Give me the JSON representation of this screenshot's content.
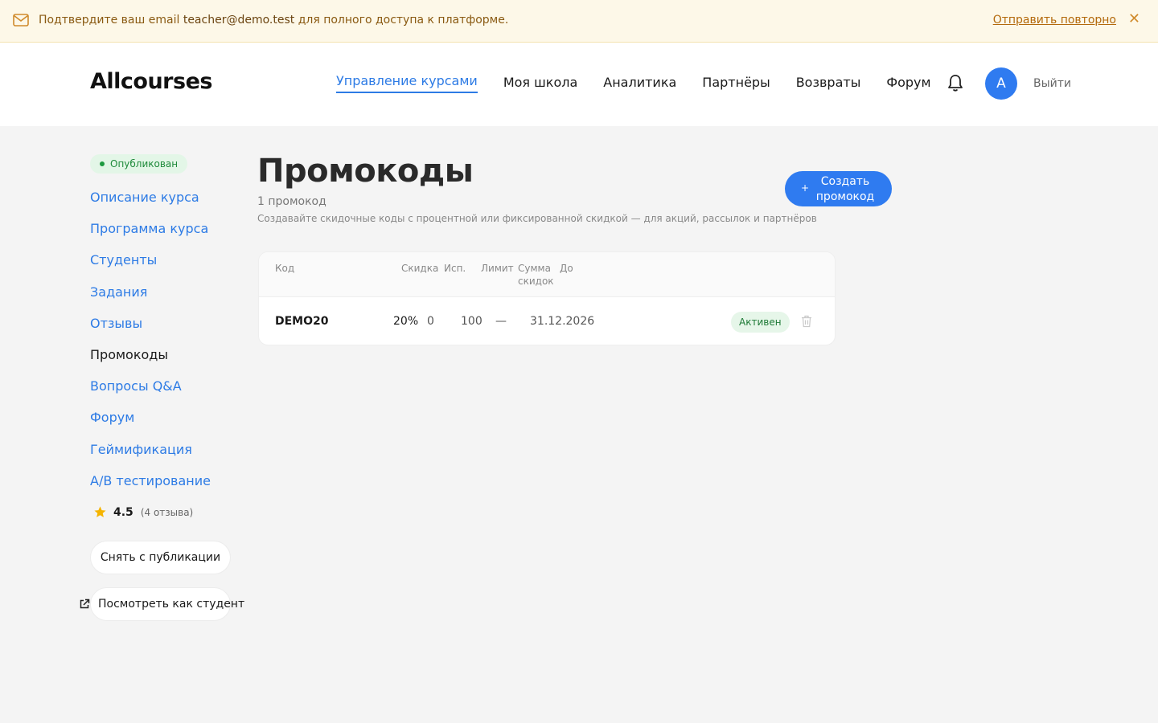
{
  "banner": {
    "icon": "mail-icon",
    "text_before": "Подтвердите ваш email ",
    "email": "teacher@demo.test",
    "text_after": " для полного доступа к платформе.",
    "resend_label": "Отправить повторно",
    "close_label": "✕"
  },
  "header": {
    "logo": "Allcourses",
    "nav": [
      "Управление курсами",
      "Моя школа",
      "Аналитика",
      "Партнёры",
      "Возвраты",
      "Форум"
    ],
    "active_nav": "Управление курсами",
    "avatar_letter": "A",
    "logout_label": "Выйти",
    "accent": "#2f7bf0"
  },
  "sidebar": {
    "status": "Опубликован",
    "menu": [
      "Описание курса",
      "Программа курса",
      "Студенты",
      "Задания",
      "Отзывы",
      "Промокоды",
      "Вопросы Q&A",
      "Форум",
      "Геймификация",
      "A/B тестирование"
    ],
    "current": "Промокоды",
    "rating": "4.5",
    "reviews": "(4 отзыва)",
    "unpublish_label": "Снять с публикации",
    "preview_label": "Посмотреть как студент"
  },
  "main": {
    "title": "Промокоды",
    "count": "1 промокод",
    "description": "Создавайте скидочные коды с процентной или фиксированной скидкой — для акций, рассылок и партнёров",
    "create_plus": "+",
    "create_label": "Создать промокод",
    "table": {
      "headers": [
        "Код",
        "Скидка",
        "Исп.",
        "Лимит",
        "Сумма скидок",
        "До"
      ],
      "rows": [
        {
          "code": "DEMO20",
          "discount": "20%",
          "used": "0",
          "limit": "100",
          "sum": "—",
          "until": "31.12.2026",
          "status": "Активен"
        }
      ]
    }
  }
}
